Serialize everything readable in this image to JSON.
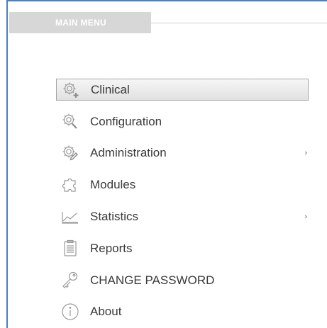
{
  "header": {
    "title": "MAIN MENU"
  },
  "menu": {
    "items": [
      {
        "label": "Clinical",
        "icon": "gear-plus-icon",
        "selected": true,
        "submenu": false
      },
      {
        "label": "Configuration",
        "icon": "gear-wrench-icon",
        "selected": false,
        "submenu": false
      },
      {
        "label": "Administration",
        "icon": "gear-pencil-icon",
        "selected": false,
        "submenu": true,
        "chevron": "›"
      },
      {
        "label": "Modules",
        "icon": "puzzle-icon",
        "selected": false,
        "submenu": false
      },
      {
        "label": "Statistics",
        "icon": "line-chart-icon",
        "selected": false,
        "submenu": true,
        "chevron": "›"
      },
      {
        "label": "Reports",
        "icon": "clipboard-icon",
        "selected": false,
        "submenu": false
      },
      {
        "label": "CHANGE PASSWORD",
        "icon": "key-icon",
        "selected": false,
        "submenu": false
      },
      {
        "label": "About",
        "icon": "info-icon",
        "selected": false,
        "submenu": false
      }
    ]
  },
  "colors": {
    "frame_border": "#4a7fc1",
    "header_bg": "#d7d7d7",
    "text": "#3a3a3a",
    "icon": "#9a9a9a"
  }
}
